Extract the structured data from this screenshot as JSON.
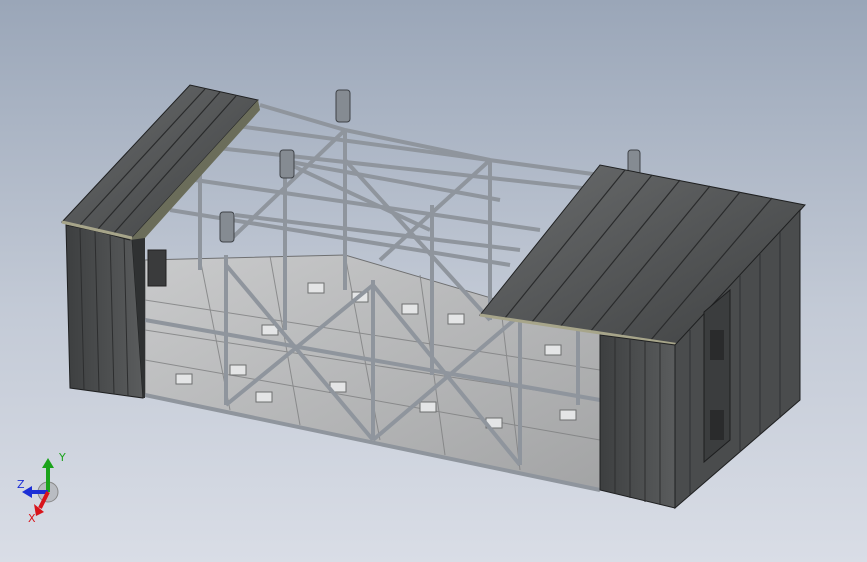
{
  "viewport": {
    "background_top": "#9aa6b8",
    "background_bottom": "#d9dde6"
  },
  "model": {
    "panel_color": "#4b4d4e",
    "panel_dark": "#37393a",
    "panel_light": "#6b6d6e",
    "trim_color": "#a7a58a",
    "steel_color": "#9aa0a8",
    "steel_dark": "#5d636b",
    "floor_color": "#b9babb",
    "floor_dark": "#8c8d8e"
  },
  "triad": {
    "x_label": "X",
    "y_label": "Y",
    "z_label": "Z",
    "x_color": "#d8141b",
    "y_color": "#1ba31b",
    "z_color": "#1c2fd6"
  }
}
